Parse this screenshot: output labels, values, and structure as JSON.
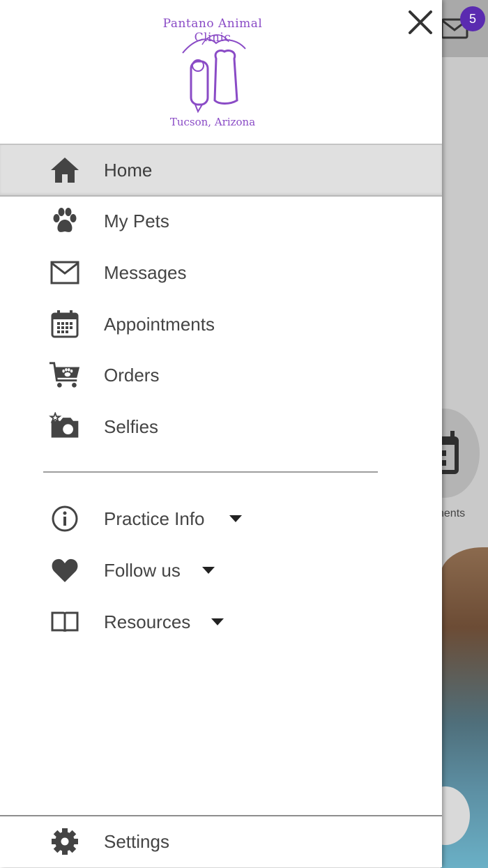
{
  "background": {
    "badge_count": "5",
    "label_fragment": "nents",
    "accent_color": "#5a2bb0"
  },
  "drawer": {
    "logo": {
      "top_text": "Pantano Animal Clinic",
      "bottom_text": "Tucson, Arizona",
      "color": "#8a4bc6"
    },
    "close_icon": "close-icon",
    "menu": [
      {
        "label": "Home",
        "icon": "home-icon",
        "active": true
      },
      {
        "label": "My Pets",
        "icon": "paw-icon"
      },
      {
        "label": "Messages",
        "icon": "envelope-icon"
      },
      {
        "label": "Appointments",
        "icon": "calendar-icon"
      },
      {
        "label": "Orders",
        "icon": "cart-icon"
      },
      {
        "label": "Selfies",
        "icon": "camera-icon"
      }
    ],
    "sections": [
      {
        "label": "Practice Info",
        "icon": "info-icon"
      },
      {
        "label": "Follow us",
        "icon": "heart-icon"
      },
      {
        "label": "Resources",
        "icon": "book-icon"
      }
    ],
    "settings": {
      "label": "Settings",
      "icon": "gear-icon"
    }
  }
}
